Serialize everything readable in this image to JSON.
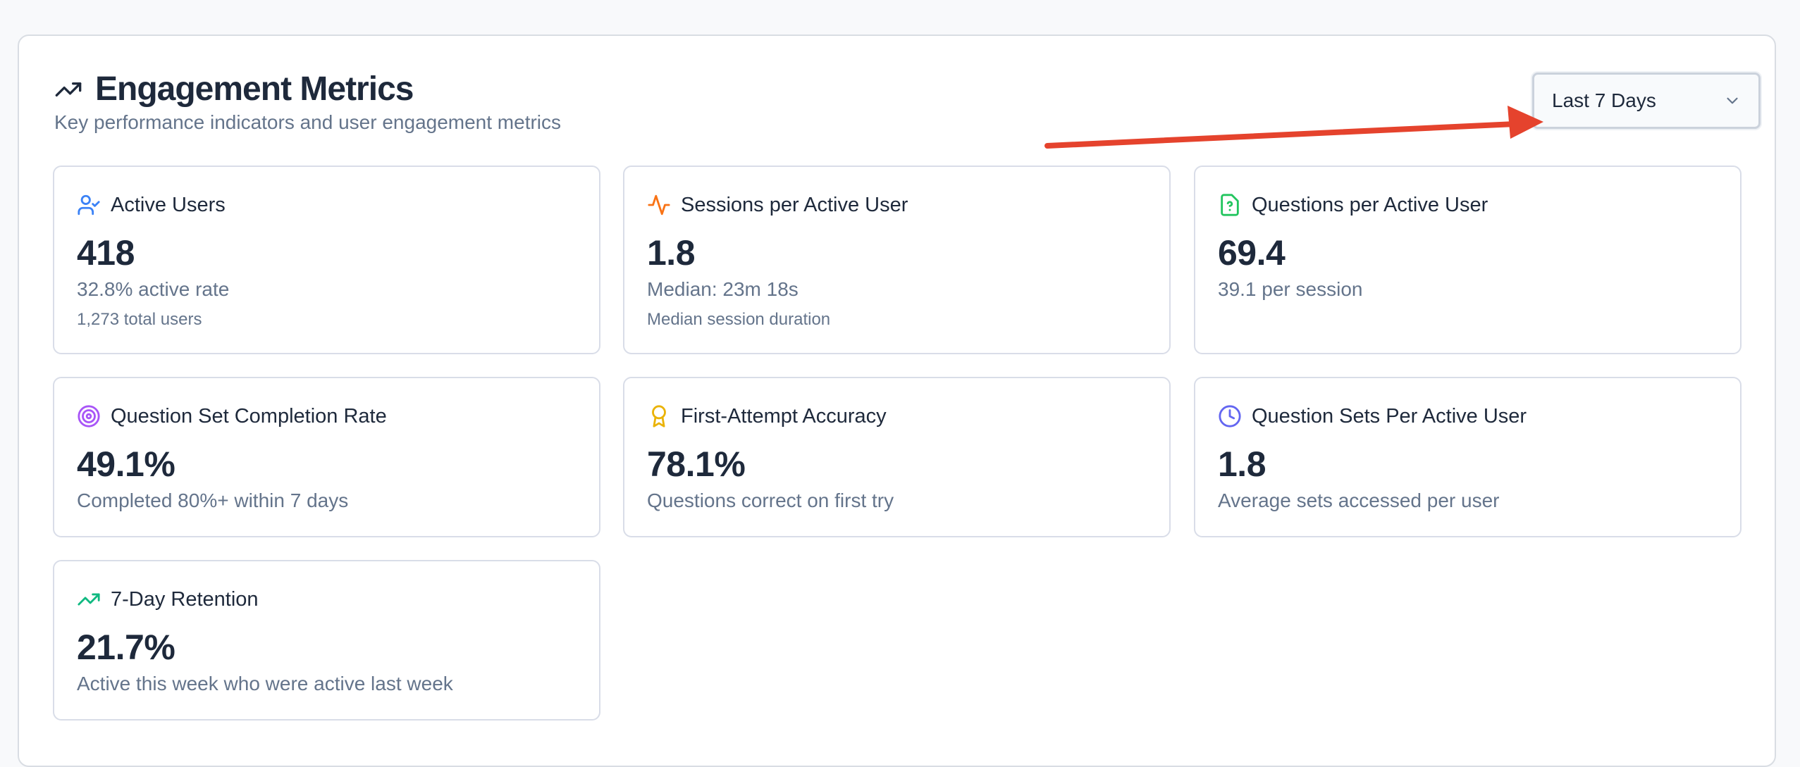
{
  "header": {
    "title": "Engagement Metrics",
    "subtitle": "Key performance indicators and user engagement metrics",
    "icon": "trending-up-icon"
  },
  "range_select": {
    "value": "Last 7 Days",
    "icon": "chevron-down-icon"
  },
  "annotation": {
    "color": "#e5432d",
    "type": "arrow pointing to date range select"
  },
  "cards": [
    {
      "label": "Active Users",
      "value": "418",
      "sub": "32.8% active rate",
      "note": "1,273 total users",
      "icon": "user-check-icon",
      "color": "#3b82f6"
    },
    {
      "label": "Sessions per Active User",
      "value": "1.8",
      "sub": "Median: 23m 18s",
      "note": "Median session duration",
      "icon": "activity-icon",
      "color": "#f97316"
    },
    {
      "label": "Questions per Active User",
      "value": "69.4",
      "sub": "39.1 per session",
      "note": "",
      "icon": "file-question-icon",
      "color": "#22c55e"
    },
    {
      "label": "Question Set Completion Rate",
      "value": "49.1%",
      "sub": "Completed 80%+ within 7 days",
      "note": "",
      "icon": "target-icon",
      "color": "#a855f7"
    },
    {
      "label": "First-Attempt Accuracy",
      "value": "78.1%",
      "sub": "Questions correct on first try",
      "note": "",
      "icon": "award-icon",
      "color": "#eab308"
    },
    {
      "label": "Question Sets Per Active User",
      "value": "1.8",
      "sub": "Average sets accessed per user",
      "note": "",
      "icon": "clock-icon",
      "color": "#6366f1"
    },
    {
      "label": "7-Day Retention",
      "value": "21.7%",
      "sub": "Active this week who were active last week",
      "note": "",
      "icon": "trending-up-icon",
      "color": "#10b981"
    }
  ]
}
